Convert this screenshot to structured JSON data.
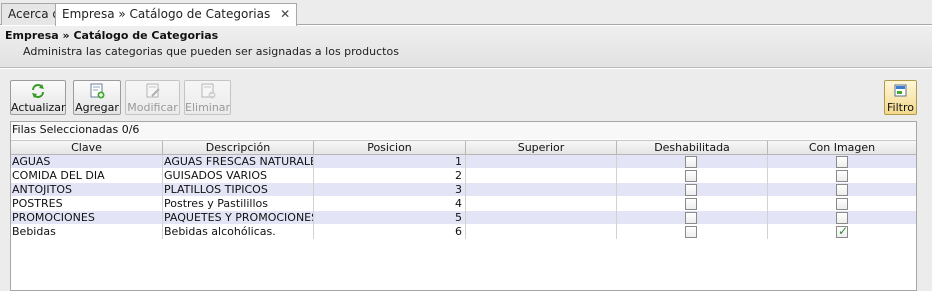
{
  "tabs": [
    {
      "label": "Acerca de",
      "active": false
    },
    {
      "label": "Empresa » Catálogo de Categorias",
      "active": true,
      "close": "✕"
    }
  ],
  "header": {
    "title": "Empresa » Catálogo de Categorias",
    "subtitle": "Administra las categorias que pueden ser asignadas a los productos"
  },
  "toolbar": {
    "actualizar": "Actualizar",
    "agregar": "Agregar",
    "modificar": "Modificar",
    "eliminar": "Eliminar",
    "filtro": "Filtro"
  },
  "table": {
    "status": "Filas Seleccionadas  0/6",
    "columns": [
      "Clave",
      "Descripción",
      "Posicion",
      "Superior",
      "Deshabilitada",
      "Con Imagen"
    ],
    "rows": [
      {
        "clave": "AGUAS",
        "descripcion": "AGUAS FRESCAS NATURALES",
        "posicion": "1",
        "superior": "",
        "deshabilitada": false,
        "con_imagen": false
      },
      {
        "clave": "COMIDA DEL DIA",
        "descripcion": "GUISADOS VARIOS",
        "posicion": "2",
        "superior": "",
        "deshabilitada": false,
        "con_imagen": false
      },
      {
        "clave": "ANTOJITOS",
        "descripcion": "PLATILLOS TIPICOS",
        "posicion": "3",
        "superior": "",
        "deshabilitada": false,
        "con_imagen": false
      },
      {
        "clave": "POSTRES",
        "descripcion": "Postres y Pastilillos",
        "posicion": "4",
        "superior": "",
        "deshabilitada": false,
        "con_imagen": false
      },
      {
        "clave": "PROMOCIONES",
        "descripcion": "PAQUETES Y PROMOCIONES",
        "posicion": "5",
        "superior": "",
        "deshabilitada": false,
        "con_imagen": false
      },
      {
        "clave": "Bebidas",
        "descripcion": "Bebidas alcohólicas.",
        "posicion": "6",
        "superior": "",
        "deshabilitada": false,
        "con_imagen": true
      }
    ]
  },
  "icons": {
    "refresh": "refresh-icon",
    "add": "add-icon",
    "edit": "edit-icon",
    "delete": "delete-icon",
    "filter": "filter-icon"
  },
  "colors": {
    "row_alt": "#e3e5f7",
    "filter_active": "#f3d98c",
    "check": "#2e8b2e"
  }
}
